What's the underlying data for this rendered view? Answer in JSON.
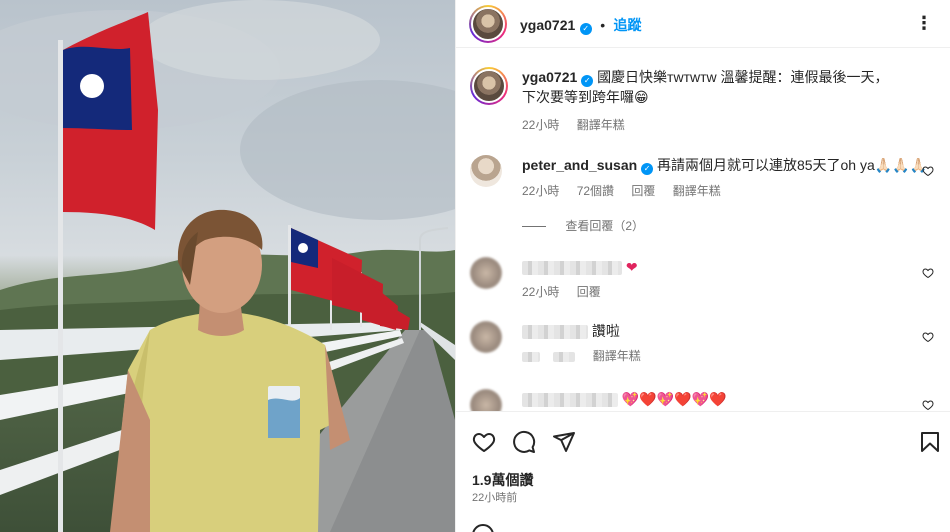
{
  "header": {
    "username": "yga0721",
    "follow_label": "追蹤",
    "more_label": "⋮"
  },
  "caption": {
    "username": "yga0721",
    "text": "國慶日快樂ᴛᴡᴛᴡᴛᴡ 溫馨提醒：連假最後一天，下次要等到跨年囉😁",
    "time": "22小時",
    "translate": "翻譯年糕"
  },
  "comments": [
    {
      "username": "peter_and_susan",
      "text": "再請兩個月就可以連放85天了oh ya🙏🏻🙏🏻🙏🏻",
      "time": "22小時",
      "likes": "72個讚",
      "reply": "回覆",
      "translate": "翻譯年糕",
      "view_replies": "查看回覆（2）"
    },
    {
      "text": "❤",
      "time": "22小時",
      "reply": "回覆"
    },
    {
      "text": "讚啦",
      "translate": "翻譯年糕"
    },
    {
      "text": "💖❤️💖❤️💖❤️"
    }
  ],
  "footer": {
    "likes": "1.9萬個讚",
    "time": "22小時前"
  },
  "icons": {
    "like": "heart-icon",
    "comment": "comment-icon",
    "share": "share-icon",
    "save": "bookmark-icon"
  },
  "colors": {
    "accent": "#0095f6",
    "flag_red": "#d0212c",
    "flag_blue": "#14297a"
  }
}
